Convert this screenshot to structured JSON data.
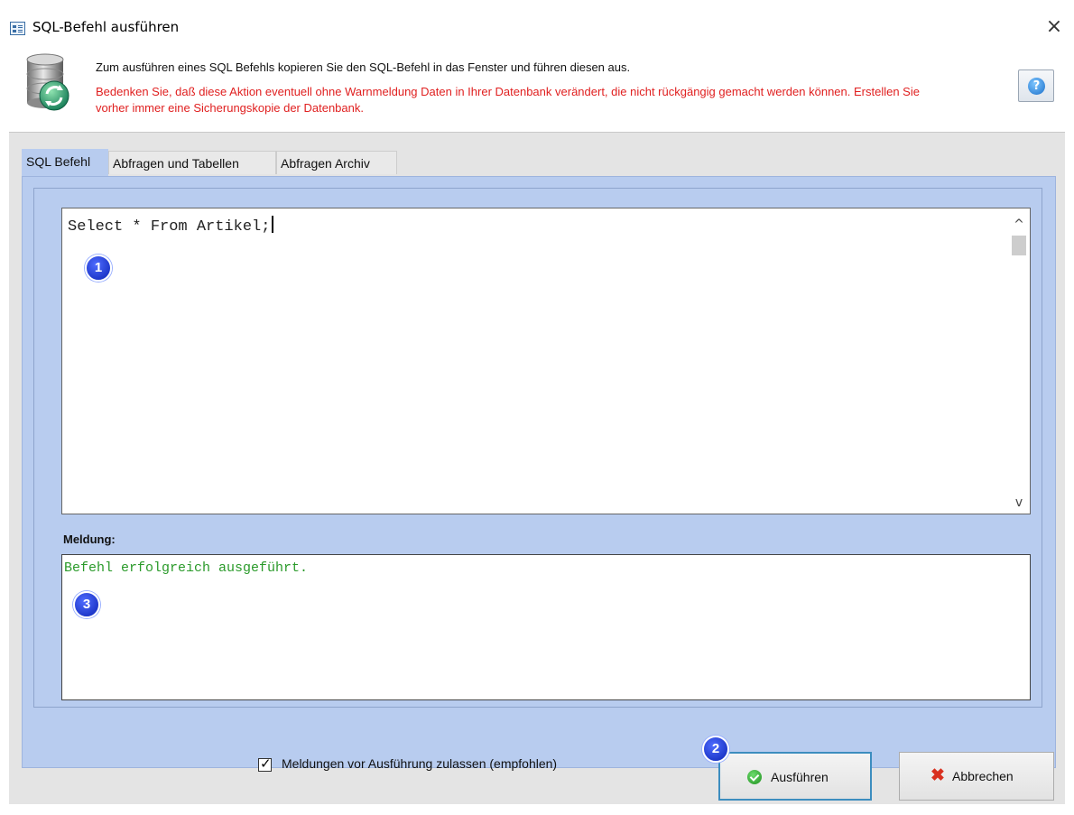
{
  "window": {
    "title": "SQL-Befehl ausführen",
    "close_symbol": "×"
  },
  "header": {
    "info": "Zum ausführen eines SQL Befehls kopieren Sie den SQL-Befehl in das Fenster und führen diesen aus.",
    "warning": "Bedenken Sie, daß diese Aktion eventuell ohne Warnmeldung Daten in Ihrer Datenbank verändert, die nicht rückgängig gemacht werden können. Erstellen Sie vorher immer eine Sicherungskopie der Datenbank.",
    "icon": "database-refresh-icon",
    "help_symbol": "?"
  },
  "tabs": [
    {
      "label": "SQL Befehl",
      "active": true
    },
    {
      "label": "Abfragen und Tabellen",
      "active": false
    },
    {
      "label": "Abfragen Archiv",
      "active": false
    }
  ],
  "editor": {
    "sql": "Select * From Artikel;"
  },
  "message": {
    "label": "Meldung:",
    "text": "Befehl erfolgreich ausgeführt.",
    "color": "#2a9a2a"
  },
  "annotations": {
    "badge_1": "1",
    "badge_2": "2",
    "badge_3": "3"
  },
  "options": {
    "confirm_checkbox_label": "Meldungen vor Ausführung zulassen (empfohlen)",
    "confirm_checked": true
  },
  "buttons": {
    "run_label": "Ausführen",
    "cancel_label": "Abbrechen"
  },
  "scrollbar": {
    "up_symbol": "^",
    "down_symbol": "v"
  },
  "colors": {
    "warning": "#e02020",
    "tab_panel": "#b8ccef",
    "badge": "#0b23b5"
  }
}
